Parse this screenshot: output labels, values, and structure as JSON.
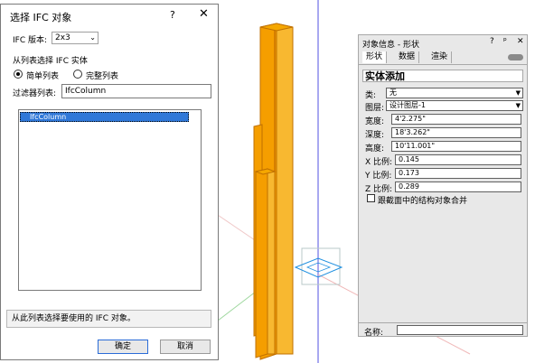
{
  "dialog": {
    "title": "选择 IFC 对象",
    "help": "?",
    "close": "✕",
    "version_label": "IFC 版本:",
    "version_value": "2x3",
    "section_label": "从列表选择 IFC 实体",
    "radio_simple": "简单列表",
    "radio_full": "完整列表",
    "filter_label": "过滤器列表:",
    "filter_value": "IfcColumn",
    "list_items": [
      "IfcColumn"
    ],
    "status_text": "从此列表选择要使用的 IFC 对象。",
    "ok_label": "确定",
    "cancel_label": "取消"
  },
  "palette": {
    "title": "对象信息 - 形状",
    "help": "?",
    "pin": "ᵖ",
    "close": "✕",
    "tabs": [
      "形状",
      "数据",
      "渲染"
    ],
    "heading": "实体添加",
    "fields": [
      {
        "label": "类:",
        "value": "无"
      },
      {
        "label": "图层:",
        "value": "设计图层-1"
      },
      {
        "label": "宽度:",
        "value": "4'2.275\""
      },
      {
        "label": "深度:",
        "value": "18'3.262\""
      },
      {
        "label": "高度:",
        "value": "10'11.001\""
      },
      {
        "label": "X 比例:",
        "value": "0.145"
      },
      {
        "label": "Y 比例:",
        "value": "0.173"
      },
      {
        "label": "Z 比例:",
        "value": "0.289"
      }
    ],
    "checkbox_label": "跟截面中的结构对象合并",
    "name_label": "名称:"
  },
  "colors": {
    "column_orange": "#f5a100",
    "selection_blue": "#3078d8",
    "axis_blue": "#4040e0"
  }
}
